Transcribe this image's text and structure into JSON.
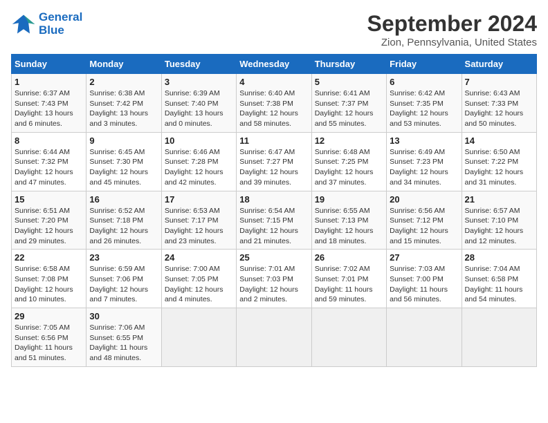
{
  "header": {
    "logo_line1": "General",
    "logo_line2": "Blue",
    "month": "September 2024",
    "location": "Zion, Pennsylvania, United States"
  },
  "weekdays": [
    "Sunday",
    "Monday",
    "Tuesday",
    "Wednesday",
    "Thursday",
    "Friday",
    "Saturday"
  ],
  "weeks": [
    [
      {
        "day": 1,
        "sunrise": "6:37 AM",
        "sunset": "7:43 PM",
        "daylight": "13 hours and 6 minutes."
      },
      {
        "day": 2,
        "sunrise": "6:38 AM",
        "sunset": "7:42 PM",
        "daylight": "13 hours and 3 minutes."
      },
      {
        "day": 3,
        "sunrise": "6:39 AM",
        "sunset": "7:40 PM",
        "daylight": "13 hours and 0 minutes."
      },
      {
        "day": 4,
        "sunrise": "6:40 AM",
        "sunset": "7:38 PM",
        "daylight": "12 hours and 58 minutes."
      },
      {
        "day": 5,
        "sunrise": "6:41 AM",
        "sunset": "7:37 PM",
        "daylight": "12 hours and 55 minutes."
      },
      {
        "day": 6,
        "sunrise": "6:42 AM",
        "sunset": "7:35 PM",
        "daylight": "12 hours and 53 minutes."
      },
      {
        "day": 7,
        "sunrise": "6:43 AM",
        "sunset": "7:33 PM",
        "daylight": "12 hours and 50 minutes."
      }
    ],
    [
      {
        "day": 8,
        "sunrise": "6:44 AM",
        "sunset": "7:32 PM",
        "daylight": "12 hours and 47 minutes."
      },
      {
        "day": 9,
        "sunrise": "6:45 AM",
        "sunset": "7:30 PM",
        "daylight": "12 hours and 45 minutes."
      },
      {
        "day": 10,
        "sunrise": "6:46 AM",
        "sunset": "7:28 PM",
        "daylight": "12 hours and 42 minutes."
      },
      {
        "day": 11,
        "sunrise": "6:47 AM",
        "sunset": "7:27 PM",
        "daylight": "12 hours and 39 minutes."
      },
      {
        "day": 12,
        "sunrise": "6:48 AM",
        "sunset": "7:25 PM",
        "daylight": "12 hours and 37 minutes."
      },
      {
        "day": 13,
        "sunrise": "6:49 AM",
        "sunset": "7:23 PM",
        "daylight": "12 hours and 34 minutes."
      },
      {
        "day": 14,
        "sunrise": "6:50 AM",
        "sunset": "7:22 PM",
        "daylight": "12 hours and 31 minutes."
      }
    ],
    [
      {
        "day": 15,
        "sunrise": "6:51 AM",
        "sunset": "7:20 PM",
        "daylight": "12 hours and 29 minutes."
      },
      {
        "day": 16,
        "sunrise": "6:52 AM",
        "sunset": "7:18 PM",
        "daylight": "12 hours and 26 minutes."
      },
      {
        "day": 17,
        "sunrise": "6:53 AM",
        "sunset": "7:17 PM",
        "daylight": "12 hours and 23 minutes."
      },
      {
        "day": 18,
        "sunrise": "6:54 AM",
        "sunset": "7:15 PM",
        "daylight": "12 hours and 21 minutes."
      },
      {
        "day": 19,
        "sunrise": "6:55 AM",
        "sunset": "7:13 PM",
        "daylight": "12 hours and 18 minutes."
      },
      {
        "day": 20,
        "sunrise": "6:56 AM",
        "sunset": "7:12 PM",
        "daylight": "12 hours and 15 minutes."
      },
      {
        "day": 21,
        "sunrise": "6:57 AM",
        "sunset": "7:10 PM",
        "daylight": "12 hours and 12 minutes."
      }
    ],
    [
      {
        "day": 22,
        "sunrise": "6:58 AM",
        "sunset": "7:08 PM",
        "daylight": "12 hours and 10 minutes."
      },
      {
        "day": 23,
        "sunrise": "6:59 AM",
        "sunset": "7:06 PM",
        "daylight": "12 hours and 7 minutes."
      },
      {
        "day": 24,
        "sunrise": "7:00 AM",
        "sunset": "7:05 PM",
        "daylight": "12 hours and 4 minutes."
      },
      {
        "day": 25,
        "sunrise": "7:01 AM",
        "sunset": "7:03 PM",
        "daylight": "12 hours and 2 minutes."
      },
      {
        "day": 26,
        "sunrise": "7:02 AM",
        "sunset": "7:01 PM",
        "daylight": "11 hours and 59 minutes."
      },
      {
        "day": 27,
        "sunrise": "7:03 AM",
        "sunset": "7:00 PM",
        "daylight": "11 hours and 56 minutes."
      },
      {
        "day": 28,
        "sunrise": "7:04 AM",
        "sunset": "6:58 PM",
        "daylight": "11 hours and 54 minutes."
      }
    ],
    [
      {
        "day": 29,
        "sunrise": "7:05 AM",
        "sunset": "6:56 PM",
        "daylight": "11 hours and 51 minutes."
      },
      {
        "day": 30,
        "sunrise": "7:06 AM",
        "sunset": "6:55 PM",
        "daylight": "11 hours and 48 minutes."
      },
      null,
      null,
      null,
      null,
      null
    ]
  ]
}
